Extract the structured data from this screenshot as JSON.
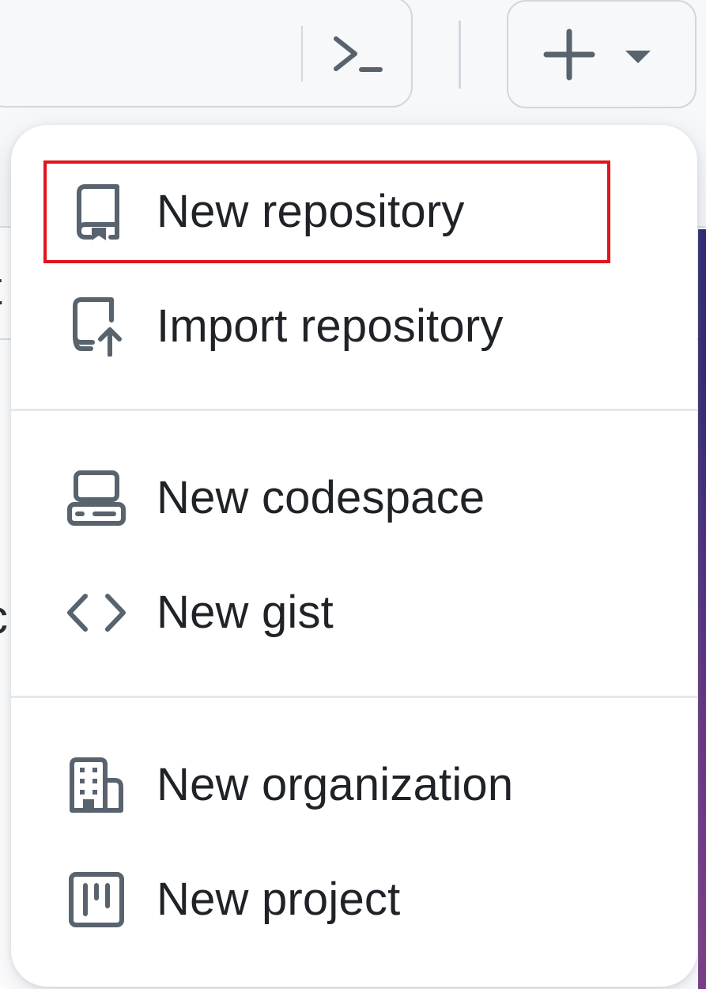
{
  "header": {
    "command_palette_icon": "terminal-icon",
    "create_button_icon": "plus-icon",
    "create_button_caret_icon": "triangle-down-icon"
  },
  "create_menu": {
    "groups": [
      {
        "items": [
          {
            "label": "New repository",
            "icon": "repo-icon",
            "highlighted": true
          },
          {
            "label": "Import repository",
            "icon": "repo-push-icon"
          }
        ]
      },
      {
        "items": [
          {
            "label": "New codespace",
            "icon": "codespaces-icon"
          },
          {
            "label": "New gist",
            "icon": "code-icon"
          }
        ]
      },
      {
        "items": [
          {
            "label": "New organization",
            "icon": "organization-icon"
          },
          {
            "label": "New project",
            "icon": "project-icon"
          }
        ]
      }
    ]
  },
  "colors": {
    "icon": "#59636e",
    "text": "#1f2328",
    "border": "#d0d7de",
    "highlight": "#e0141b",
    "menu_bg": "#ffffff"
  }
}
